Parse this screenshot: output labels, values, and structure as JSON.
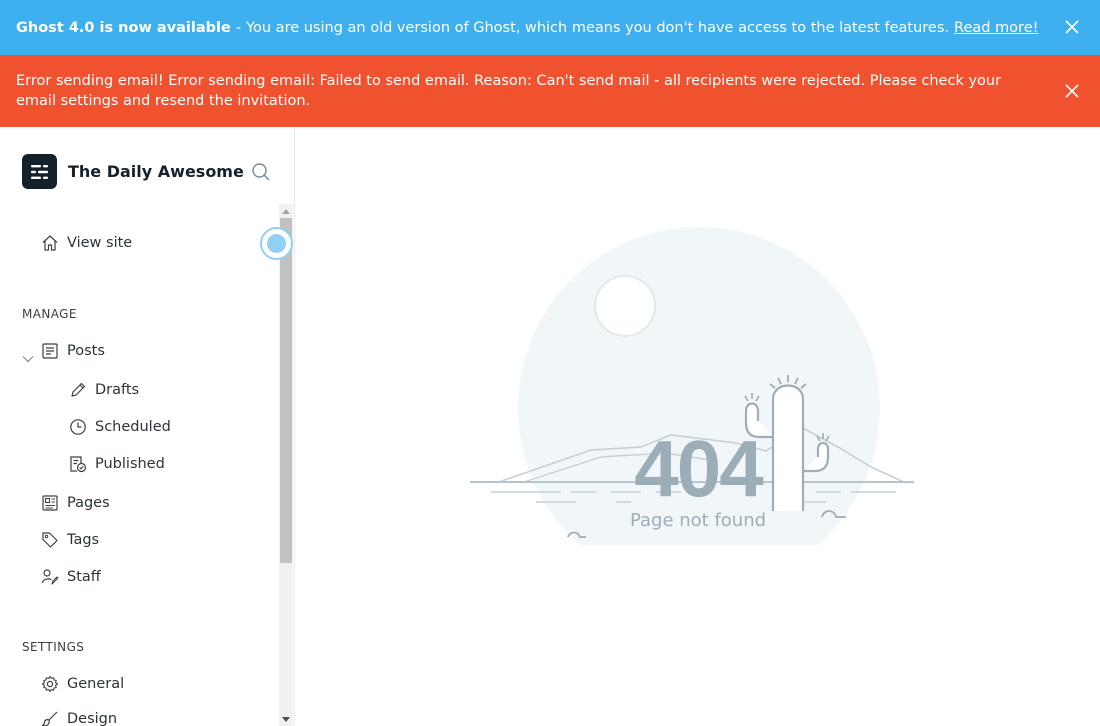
{
  "update_banner": {
    "title": "Ghost 4.0 is now available",
    "separator": "-",
    "message": "You are using an old version of Ghost, which means you don't have access to the latest features.",
    "link": "Read more!",
    "close_icon": "close-icon",
    "color": "#3eb0ef"
  },
  "error_banner": {
    "message": "Error sending email! Error sending email: Failed to send email. Reason: Can't send mail - all recipients were rejected. Please check your email settings and resend the invitation.",
    "close_icon": "close-icon",
    "color": "#f05230"
  },
  "sidebar": {
    "brand": {
      "name": "The Daily Awesome",
      "logo_icon": "ghost-logo-icon"
    },
    "search_icon": "search-icon",
    "view_site": {
      "label": "View site",
      "icon": "home-icon"
    },
    "sections": {
      "manage": "MANAGE",
      "settings": "SETTINGS"
    },
    "manage_items": {
      "posts": {
        "label": "Posts",
        "icon": "posts-icon"
      },
      "drafts": {
        "label": "Drafts",
        "icon": "pencil-icon"
      },
      "scheduled": {
        "label": "Scheduled",
        "icon": "clock-icon"
      },
      "published": {
        "label": "Published",
        "icon": "published-icon"
      },
      "pages": {
        "label": "Pages",
        "icon": "pages-icon"
      },
      "tags": {
        "label": "Tags",
        "icon": "tag-icon"
      },
      "staff": {
        "label": "Staff",
        "icon": "staff-icon"
      }
    },
    "settings_items": {
      "general": {
        "label": "General",
        "icon": "gear-icon"
      },
      "design": {
        "label": "Design",
        "icon": "brush-icon"
      }
    }
  },
  "main": {
    "error_code": "404",
    "error_message": "Page not found"
  }
}
